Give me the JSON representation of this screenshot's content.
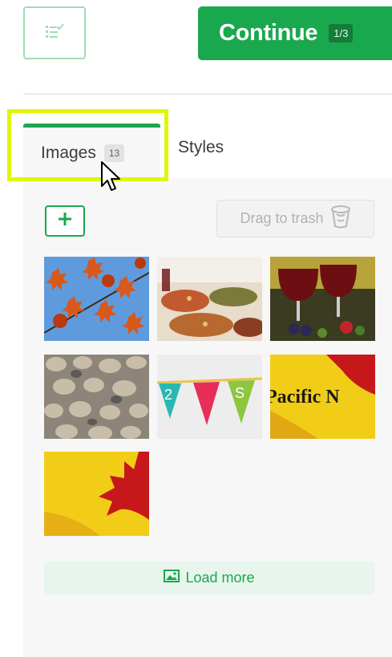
{
  "toolbar": {
    "checklist_icon": "checklist-icon",
    "continue_label": "Continue",
    "step_badge": "1/3",
    "accent_color": "#1aa84e"
  },
  "tabs": [
    {
      "label": "Images",
      "count": "13",
      "active": true
    },
    {
      "label": "Styles",
      "active": false
    }
  ],
  "images_panel": {
    "add_icon": "plus-icon",
    "trash_label": "Drag to trash",
    "trash_icon": "trash-icon",
    "thumbnails": [
      {
        "subject": "autumn-leaves-sky"
      },
      {
        "subject": "food-platters"
      },
      {
        "subject": "wine-glasses"
      },
      {
        "subject": "pebbles"
      },
      {
        "subject": "bunting-flags",
        "flag_texts": [
          "2",
          "S"
        ]
      },
      {
        "subject": "pacific-nw-title",
        "text": "Pacific N"
      },
      {
        "subject": "red-yellow-leaf"
      }
    ],
    "load_more_label": "Load more",
    "load_more_icon": "image-icon"
  },
  "highlight_color": "#dff700"
}
